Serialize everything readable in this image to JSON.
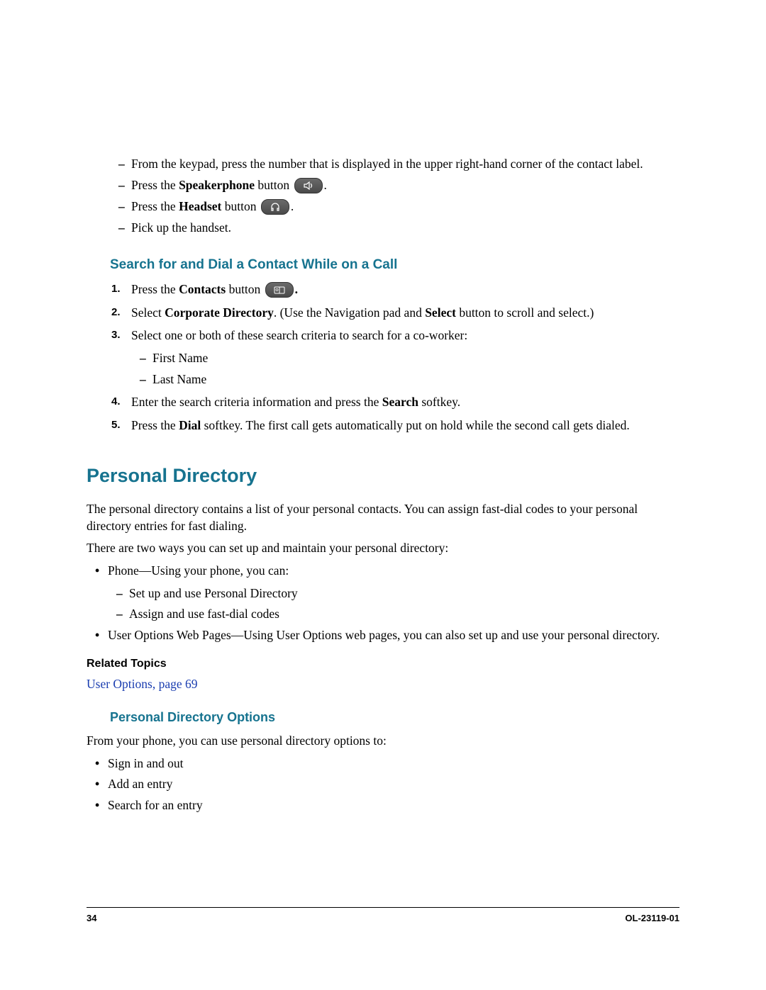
{
  "intro_list": {
    "item1": "From the keypad, press the number that is displayed in the upper right-hand corner of the contact label.",
    "item2a": "Press the ",
    "item2b": "Speakerphone",
    "item2c": " button ",
    "item2d": ".",
    "item3a": "Press the ",
    "item3b": "Headset",
    "item3c": " button ",
    "item3d": ".",
    "item4": "Pick up the handset."
  },
  "section1": {
    "heading": "Search for and Dial a Contact While on a Call",
    "step1a": "Press the ",
    "step1b": "Contacts",
    "step1c": " button ",
    "step1d": ".",
    "step2a": "Select ",
    "step2b": "Corporate Directory",
    "step2c": ". (Use the Navigation pad and ",
    "step2d": "Select",
    "step2e": " button to scroll and select.)",
    "step3": "Select one or both of these search criteria to search for a co-worker:",
    "step3_sub1": "First Name",
    "step3_sub2": "Last Name",
    "step4a": "Enter the search criteria information and press the ",
    "step4b": "Search",
    "step4c": " softkey.",
    "step5a": "Press the ",
    "step5b": "Dial",
    "step5c": " softkey. The first call gets automatically put on hold while the second call gets dialed."
  },
  "section2": {
    "heading": "Personal Directory",
    "p1": "The personal directory contains a list of your personal contacts. You can assign fast-dial codes to your personal directory entries for fast dialing.",
    "p2": "There are two ways you can set up and maintain your personal directory:",
    "b1": "Phone—Using your phone, you can:",
    "b1s1": "Set up and use Personal Directory",
    "b1s2": "Assign and use fast-dial codes",
    "b2": "User Options Web Pages—Using User Options web pages, you can also set up and use your personal directory.",
    "related_heading": "Related Topics",
    "related_link": "User Options, page 69"
  },
  "section3": {
    "heading": "Personal Directory Options",
    "p1": "From your phone, you can use personal directory options to:",
    "b1": "Sign in and out",
    "b2": "Add an entry",
    "b3": "Search for an entry"
  },
  "footer": {
    "page": "34",
    "docid": "OL-23119-01"
  },
  "icons": {
    "speakerphone": "speakerphone-icon",
    "headset": "headset-icon",
    "contacts": "contacts-icon"
  }
}
